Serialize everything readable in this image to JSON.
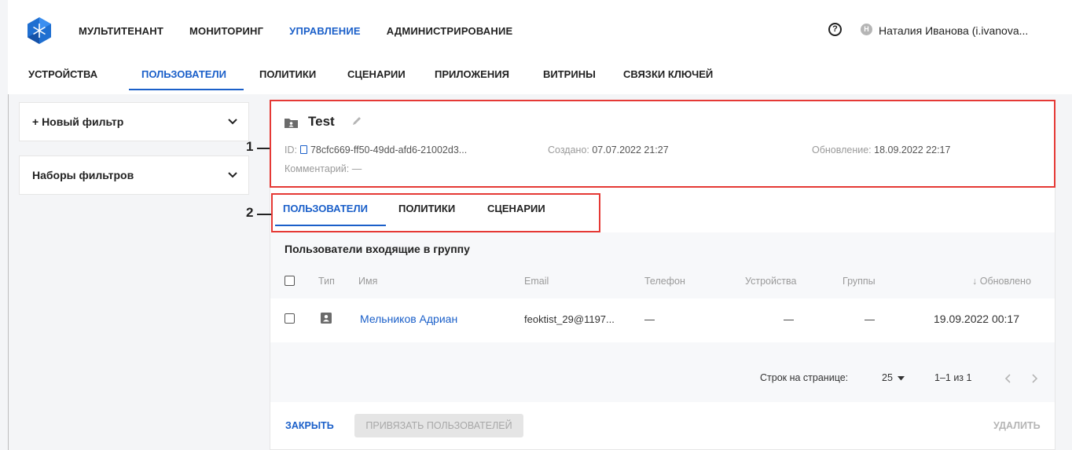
{
  "topnav": {
    "items": [
      {
        "label": "МУЛЬТИТЕНАНТ"
      },
      {
        "label": "МОНИТОРИНГ"
      },
      {
        "label": "УПРАВЛЕНИЕ"
      },
      {
        "label": "АДМИНИСТРИРОВАНИЕ"
      }
    ],
    "help_glyph": "?",
    "avatar_letter": "Н",
    "user_name": "Наталия Иванова (i.ivanova..."
  },
  "subnav": {
    "items": [
      {
        "label": "УСТРОЙСТВА"
      },
      {
        "label": "ПОЛЬЗОВАТЕЛИ"
      },
      {
        "label": "ПОЛИТИКИ"
      },
      {
        "label": "СЦЕНАРИИ"
      },
      {
        "label": "ПРИЛОЖЕНИЯ"
      },
      {
        "label": "ВИТРИНЫ"
      },
      {
        "label": "СВЯЗКИ КЛЮЧЕЙ"
      }
    ]
  },
  "sidebar": {
    "new_filter": "+ Новый фильтр",
    "filter_sets": "Наборы фильтров"
  },
  "group": {
    "title": "Test",
    "id_label": "ID:",
    "id_value": "78cfc669-ff50-49dd-afd6-21002d3...",
    "created_label": "Создано:",
    "created_value": "07.07.2022 21:27",
    "updated_label": "Обновление:",
    "updated_value": "18.09.2022 22:17",
    "comment_label": "Комментарий:",
    "comment_value": "—"
  },
  "callouts": {
    "one": "1",
    "two": "2"
  },
  "tabs": [
    {
      "label": "ПОЛЬЗОВАТЕЛИ"
    },
    {
      "label": "ПОЛИТИКИ"
    },
    {
      "label": "СЦЕНАРИИ"
    }
  ],
  "table": {
    "title": "Пользователи входящие в группу",
    "columns": {
      "type": "Тип",
      "name": "Имя",
      "email": "Email",
      "phone": "Телефон",
      "devices": "Устройства",
      "groups": "Группы",
      "updated": "↓ Обновлено"
    },
    "rows": [
      {
        "type_icon": "user-card-icon",
        "name": "Мельников Адриан",
        "email": "feoktist_29@1197...",
        "phone": "—",
        "devices": "—",
        "groups": "—",
        "updated": "19.09.2022 00:17"
      }
    ]
  },
  "pagination": {
    "rows_label": "Строк на странице:",
    "rows_value": "25",
    "range": "1–1 из 1"
  },
  "footer": {
    "close": "ЗАКРЫТЬ",
    "bind": "ПРИВЯЗАТЬ ПОЛЬЗОВАТЕЛЕЙ",
    "delete": "УДАЛИТЬ"
  },
  "colors": {
    "accent": "#1a5fc9",
    "highlight": "#e53935"
  }
}
